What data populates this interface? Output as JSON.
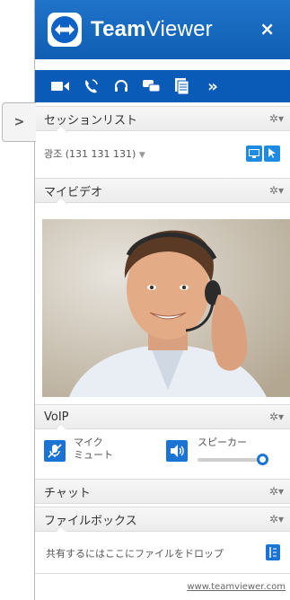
{
  "header": {
    "brand_bold": "Team",
    "brand_light": "Viewer",
    "close_glyph": "×"
  },
  "toolbar": {
    "icons": [
      "video-camera-icon",
      "phone-icon",
      "headset-icon",
      "chat-icon",
      "file-icon",
      "more-icon"
    ],
    "more_glyph": "»"
  },
  "collapse_glyph": ">",
  "sessions": {
    "title": "セッションリスト",
    "item": "광조 (131 131 131)",
    "item_dropdown": "▼"
  },
  "video": {
    "title": "マイビデオ"
  },
  "voip": {
    "title": "VoIP",
    "mic_label_1": "マイク",
    "mic_label_2": "ミュート",
    "speaker_label": "スピーカー",
    "speaker_volume": 1.0
  },
  "chat": {
    "title": "チャット"
  },
  "filebox": {
    "title": "ファイルボックス",
    "drop_text": "共有するにはここにファイルをドロップ"
  },
  "footer": {
    "link": "www.teamviewer.com"
  },
  "gear_glyph": "✲▾",
  "colors": {
    "brand": "#0f62c5",
    "toolbar": "#0a5bb8",
    "accent": "#1b74d4"
  }
}
